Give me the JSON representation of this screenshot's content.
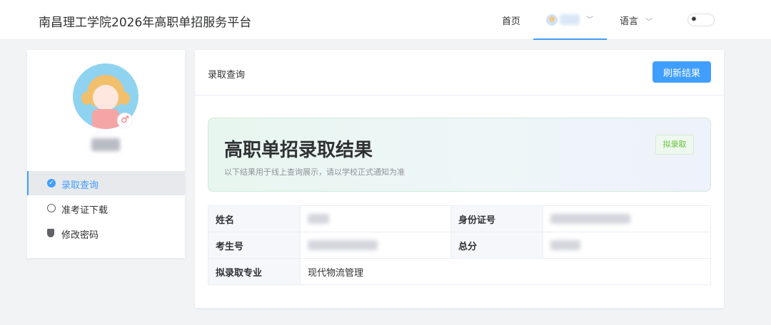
{
  "header": {
    "site_title": "南昌理工学院2026年高职单招服务平台",
    "nav_home": "首页",
    "nav_language": "语言"
  },
  "sidebar": {
    "items": [
      {
        "label": "录取查询",
        "icon": "check-circle-icon",
        "active": true
      },
      {
        "label": "准考证下载",
        "icon": "circle-icon",
        "active": false
      },
      {
        "label": "修改密码",
        "icon": "shield-icon",
        "active": false
      }
    ]
  },
  "main": {
    "title": "录取查询",
    "refresh_label": "刷新结果",
    "result_title": "高职单招录取结果",
    "result_subtitle": "以下结果用于线上查询展示，请以学校正式通知为准",
    "status_tag": "拟录取",
    "table": {
      "name_label": "姓名",
      "id_label": "身份证号",
      "exam_no_label": "考生号",
      "score_label": "总分",
      "major_label": "拟录取专业",
      "major_value": "现代物流管理"
    }
  },
  "colors": {
    "accent": "#409eff",
    "success": "#67c23a"
  }
}
